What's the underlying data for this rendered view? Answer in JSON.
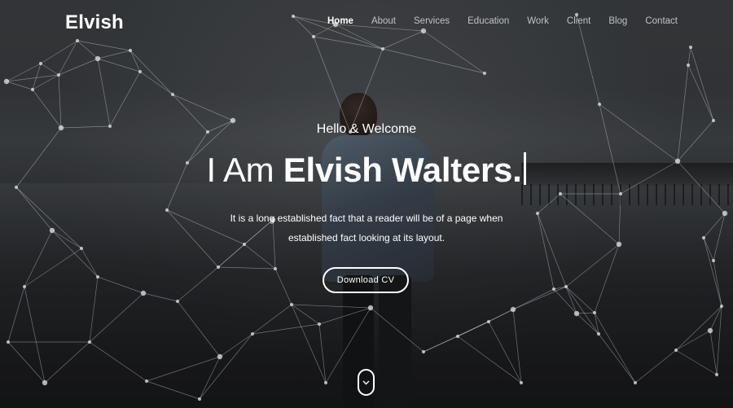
{
  "brand": {
    "name": "Elvish"
  },
  "nav": {
    "items": [
      {
        "label": "Home",
        "active": true
      },
      {
        "label": "About"
      },
      {
        "label": "Services"
      },
      {
        "label": "Education"
      },
      {
        "label": "Work"
      },
      {
        "label": "Client"
      },
      {
        "label": "Blog"
      },
      {
        "label": "Contact"
      }
    ]
  },
  "hero": {
    "greeting": "Hello & Welcome",
    "headline_prefix": "I Am ",
    "headline_name": "Elvish Walters.",
    "description_line1": "It is a long established fact that a reader will be of a page when",
    "description_line2": "established fact looking at its layout.",
    "cta_label": "Download CV"
  },
  "icons": {
    "scroll_down": "chevron-down-icon"
  },
  "colors": {
    "text": "#ffffff",
    "nav_inactive": "#bfc3c6",
    "background": "#2a2c2e"
  }
}
